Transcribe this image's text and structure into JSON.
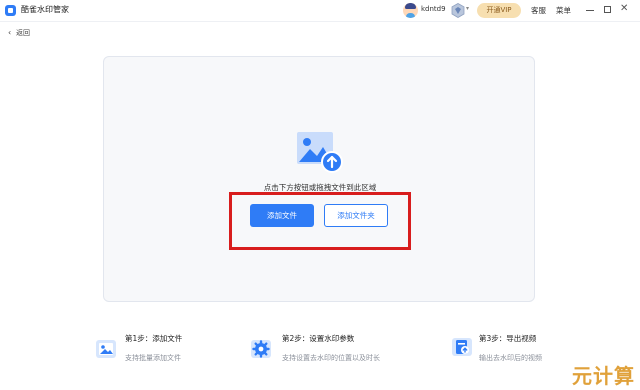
{
  "titlebar": {
    "app_title": "酷雀水印管家",
    "username": "kdntd9",
    "vip_button": "开通VIP",
    "vip_arrow": "▾",
    "service": "客服",
    "menu": "菜单",
    "close_glyph": "✕"
  },
  "back": {
    "icon": "‹",
    "label": "返回"
  },
  "upload": {
    "hint": "点击下方按钮或拖拽文件到此区域",
    "add_file": "添加文件",
    "add_folder": "添加文件夹"
  },
  "steps": [
    {
      "title": "第1步：添加文件",
      "desc": "支持批量添加文件",
      "icon": "image-file-icon"
    },
    {
      "title": "第2步：设置水印参数",
      "desc": "支持设置去水印的位置以及时长",
      "icon": "gear-icon"
    },
    {
      "title": "第3步：导出视频",
      "desc": "输出去水印后的视频",
      "icon": "export-icon"
    }
  ],
  "watermark": "元计算",
  "colors": {
    "accent": "#2f7cf6",
    "highlight": "#d81d1d",
    "vip": "#f7dfb0"
  }
}
